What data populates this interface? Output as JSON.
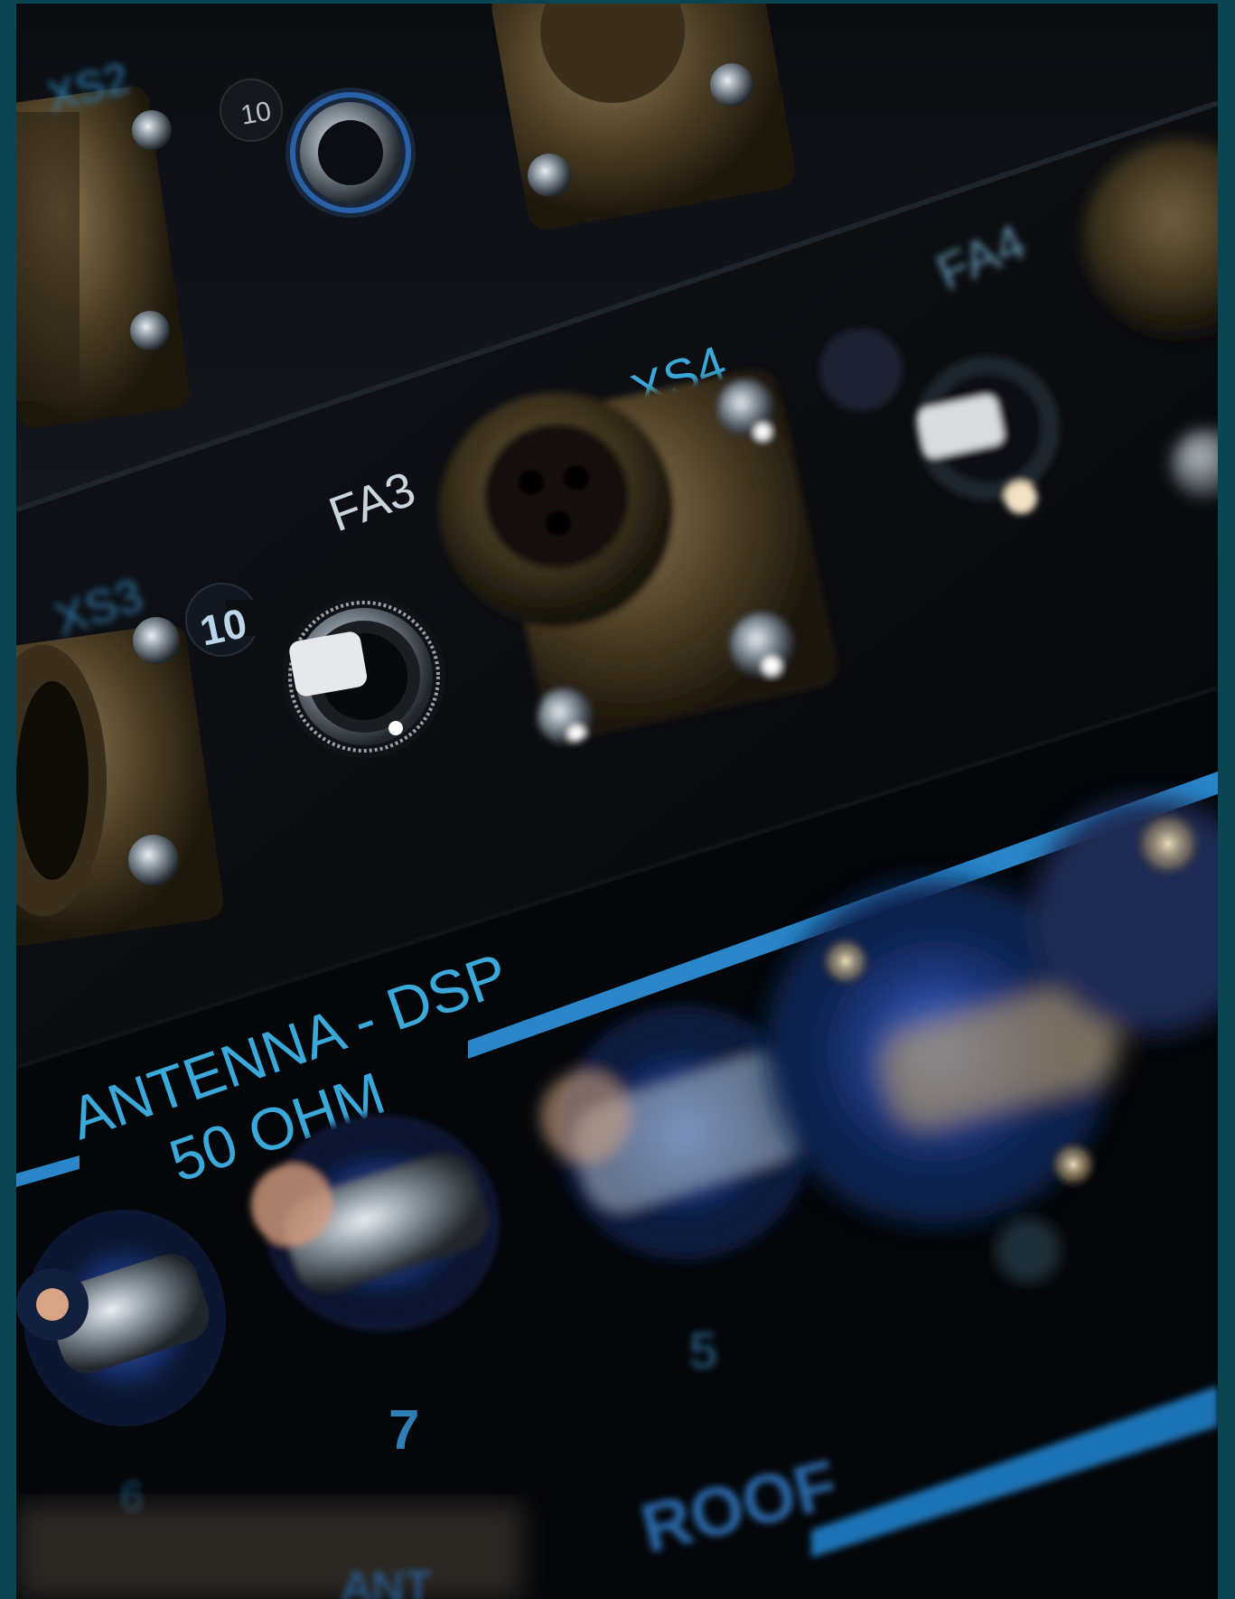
{
  "photo": {
    "subject": "rack-mounted radio equipment panel",
    "frame_color": "#0d4452",
    "panel_color": "#06080b",
    "label_color": "#3aa8d8",
    "label_white": "#c9d6e0",
    "labels": {
      "xs2": "XS2",
      "knob_top": "10",
      "fa4": "FA4",
      "xs4": "XS4",
      "fa3": "FA3",
      "xs3": "XS3",
      "knob_mid": "10",
      "antenna": "ANTENNA - DSP",
      "ohm": "50 OHM",
      "num_5": "5",
      "num_7": "7",
      "num_6": "6",
      "bottom_word": "ROOF",
      "bottom_fragment": "ANT"
    }
  }
}
